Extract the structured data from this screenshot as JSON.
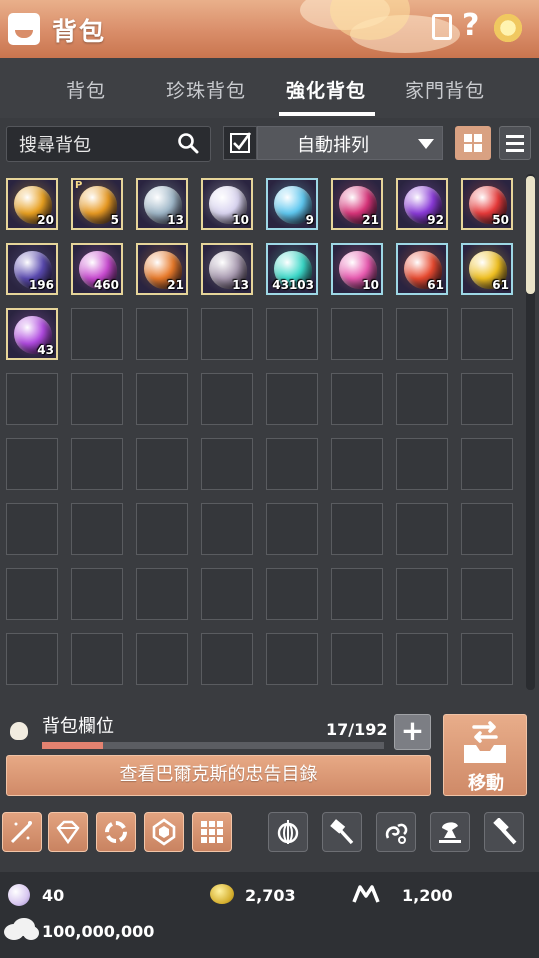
{
  "header": {
    "title": "背包",
    "icons": [
      "bag-icon",
      "document-icon",
      "help-icon",
      "flower-icon"
    ]
  },
  "tabs": [
    {
      "label": "背包",
      "active": false
    },
    {
      "label": "珍珠背包",
      "active": false
    },
    {
      "label": "強化背包",
      "active": true
    },
    {
      "label": "家門背包",
      "active": false
    }
  ],
  "search": {
    "placeholder": "搜尋背包"
  },
  "sort": {
    "checked": true,
    "label": "自動排列"
  },
  "inventory": {
    "columns": 8,
    "rows": 8,
    "items": [
      {
        "count": "20",
        "color": "#e8a020",
        "pmark": ""
      },
      {
        "count": "5",
        "color": "#e89a22",
        "pmark": "P"
      },
      {
        "count": "13",
        "color": "#9fb7c8",
        "pmark": ""
      },
      {
        "count": "10",
        "color": "#d9d4f0",
        "pmark": ""
      },
      {
        "count": "9",
        "color": "#5fc8f0",
        "pmark": "",
        "cyan": true
      },
      {
        "count": "21",
        "color": "#d8347a",
        "pmark": ""
      },
      {
        "count": "92",
        "color": "#8a3ad8",
        "pmark": ""
      },
      {
        "count": "50",
        "color": "#e83a3a",
        "pmark": ""
      },
      {
        "count": "196",
        "color": "#5a4ab0",
        "pmark": ""
      },
      {
        "count": "460",
        "color": "#c84ad0",
        "pmark": ""
      },
      {
        "count": "21",
        "color": "#e87a2a",
        "pmark": ""
      },
      {
        "count": "13",
        "color": "#a89ab0",
        "pmark": ""
      },
      {
        "count": "43103",
        "color": "#3ad8c8",
        "pmark": "",
        "cyan": true
      },
      {
        "count": "10",
        "color": "#e85ab0",
        "pmark": "",
        "cyan": true
      },
      {
        "count": "61",
        "color": "#e84a30",
        "pmark": "",
        "cyan": true
      },
      {
        "count": "61",
        "color": "#f0c020",
        "pmark": "",
        "cyan": true
      },
      {
        "count": "43",
        "color": "#b04ae0",
        "pmark": ""
      }
    ]
  },
  "capacity": {
    "label": "背包欄位",
    "count": "17/192",
    "used": 17,
    "total": 192
  },
  "buttons": {
    "expand": "+",
    "advice": "查看巴爾克斯的忠告目錄",
    "move": "移動"
  },
  "tools": [
    "sword-icon",
    "gem-icon",
    "rings-icon",
    "crystal-icon",
    "grid-icon",
    "lantern-icon",
    "hammer-icon",
    "swirl-icon",
    "anvil-icon",
    "mallet-icon"
  ],
  "currency": {
    "pearl": "40",
    "silver_coin": "2,703",
    "m_token": "1,200",
    "cloud": "100,000,000"
  }
}
